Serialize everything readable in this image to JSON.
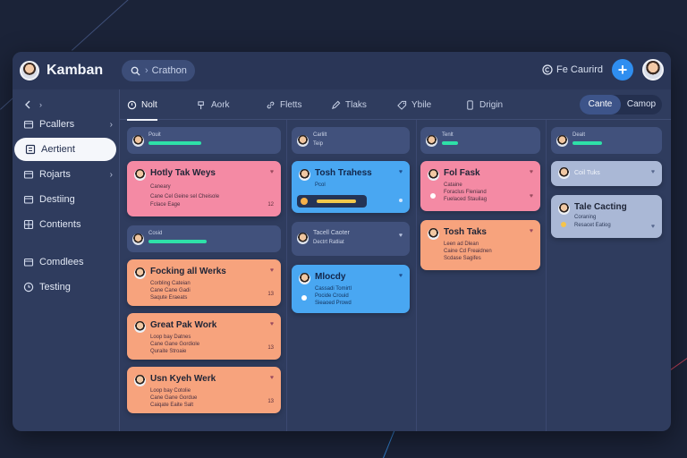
{
  "app": {
    "title": "Kamban"
  },
  "search": {
    "label": "Crathon"
  },
  "header": {
    "favorite_label": "Fe Caurird"
  },
  "sidebar": {
    "items": [
      {
        "label": "",
        "icon": "back-arrow-icon"
      },
      {
        "label": "Pcallers",
        "icon": "folder-icon"
      },
      {
        "label": "Aertient",
        "icon": "list-icon"
      },
      {
        "label": "Rojarts",
        "icon": "folder-icon"
      },
      {
        "label": "Destiing",
        "icon": "folder-icon"
      },
      {
        "label": "Contients",
        "icon": "grid-icon"
      },
      {
        "label": "Comdlees",
        "icon": "folder-icon"
      },
      {
        "label": "Testing",
        "icon": "clock-icon"
      }
    ]
  },
  "tabs": [
    {
      "label": "Nolt",
      "icon": "circle-icon"
    },
    {
      "label": "Aork",
      "icon": "tool-icon"
    },
    {
      "label": "Fletts",
      "icon": "link-icon"
    },
    {
      "label": "Tlaks",
      "icon": "pen-icon"
    },
    {
      "label": "Ybile",
      "icon": "tag-icon"
    },
    {
      "label": "Drigin",
      "icon": "phone-icon"
    }
  ],
  "segmented": {
    "options": [
      "Cante",
      "Camop"
    ],
    "selected": "Cante"
  },
  "columns": [
    {
      "groups": [
        {
          "header": {
            "label": "Pouit",
            "progress": 0.55
          },
          "cards": [
            {
              "title": "Hotly Tak Weys",
              "color": "pink",
              "sub1": "Caneary",
              "sub2": "Cane Cel Geine sel Cheisole",
              "sub3": "Fclace Eage",
              "count": "12"
            }
          ]
        },
        {
          "header": {
            "label": "Cosid",
            "progress": 0.6
          },
          "cards": [
            {
              "title": "Focking all Werks",
              "color": "salmon",
              "sub1": "Corbling Cateian",
              "sub2": "Cane Cane Gadi",
              "sub3": "Saqute Eraeats",
              "count": "13"
            },
            {
              "title": "Great Pak Work",
              "color": "salmon",
              "sub1": "Loop bay Datnes",
              "sub2": "Cane Gane Gordiole",
              "sub3": "Quraite Stroaie",
              "count": "13"
            },
            {
              "title": "Usn Kyeh Werk",
              "color": "salmon",
              "sub1": "Loop bay Cotolie",
              "sub2": "Cane Gane Gordue",
              "sub3": "Caiqate Eaite Salt",
              "count": "13"
            }
          ]
        }
      ]
    },
    {
      "groups": [
        {
          "header": {
            "label": "Carlilt",
            "sublabel": "Teip"
          },
          "cards": [
            {
              "title": "Tosh Trahess",
              "color": "blue",
              "sub1": "Pcol",
              "count": "",
              "has_inner_bar": true
            }
          ]
        },
        {
          "header": {
            "label": "Tacell Caoter",
            "sublabel": "Dectrt Ratliat"
          },
          "cards": [
            {
              "title": "Mlocdy",
              "color": "blue",
              "sub1": "Cassadi Tomirtl",
              "sub2": "Pocide Crouid",
              "sub3": "Sieaoed Prowd",
              "count": ""
            }
          ]
        }
      ]
    },
    {
      "groups": [
        {
          "header": {
            "label": "Tenlt",
            "progress": 0.25
          },
          "cards": [
            {
              "title": "Fol Fask",
              "color": "pink",
              "sub1": "Cataine",
              "sub2": "Foraclus Fleniand",
              "sub3": "Fuelaced Stauilag",
              "count": ""
            },
            {
              "title": "Tosh Taks",
              "color": "salmon",
              "sub1": "Leen ad Dlean",
              "sub2": "Caine Cd Freaidnen",
              "sub3": "Scdase Sagifes",
              "count": ""
            }
          ]
        }
      ]
    },
    {
      "groups": [
        {
          "header": {
            "label": "Dealt",
            "progress": 0.55
          },
          "cards": [
            {
              "title": "Coil Tuks",
              "color": "grey",
              "count": ""
            },
            {
              "title": "Tale Cacting",
              "color": "grey",
              "sub1": "Coraning",
              "sub2": "Resacet Eatiog",
              "count": ""
            }
          ]
        }
      ]
    }
  ]
}
